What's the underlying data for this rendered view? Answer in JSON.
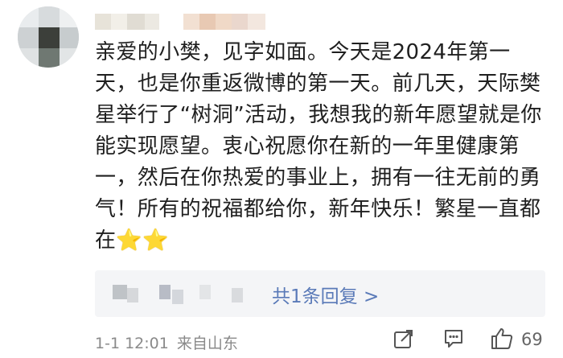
{
  "comment": {
    "content": "亲爱的小樊，见字如面。今天是2024年第一天，也是你重返微博的第一天。前几天，天际樊星举行了“树洞”活动，我想我的新年愿望就是你能实现愿望。衷心祝愿你在新的一年里健康第一，然后在你热爱的事业上，拥有一往无前的勇气！所有的祝福都给你，新年快乐！繁星一直都在",
    "stars": "⭐⭐",
    "replies": {
      "link_text": "共1条回复 >"
    },
    "meta": {
      "time": "1-1 12:01",
      "location": "来自山东"
    },
    "actions": {
      "like_count": "69"
    }
  },
  "icons": {
    "share": "share-icon",
    "comment": "comment-icon",
    "like": "thumbs-up-icon"
  },
  "colors": {
    "link": "#5a7ab8",
    "meta": "#8a8a8a",
    "reply_bg": "#f4f5f7"
  }
}
